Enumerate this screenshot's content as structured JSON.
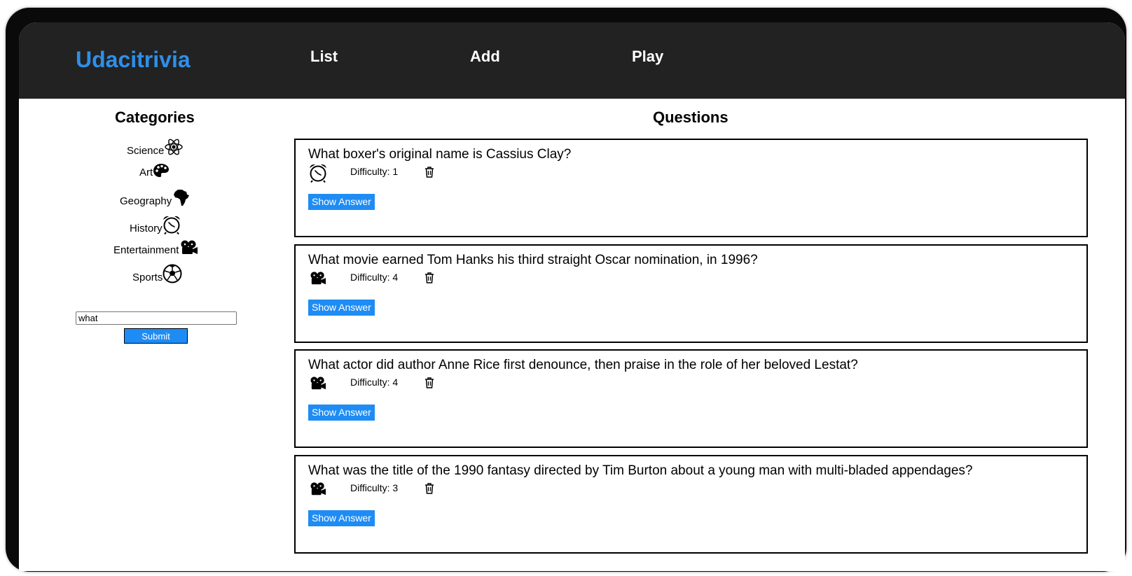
{
  "navbar": {
    "brand": "Udacitrivia",
    "links": [
      "List",
      "Add",
      "Play"
    ]
  },
  "sidebar": {
    "title": "Categories",
    "categories": [
      {
        "label": "Science",
        "icon": "science-atom-icon"
      },
      {
        "label": "Art",
        "icon": "art-palette-icon"
      },
      {
        "label": "Geography",
        "icon": "geography-africa-icon"
      },
      {
        "label": "History",
        "icon": "history-alarm-clock-icon"
      },
      {
        "label": "Entertainment",
        "icon": "entertainment-film-projector-icon"
      },
      {
        "label": "Sports",
        "icon": "sports-soccer-ball-icon"
      }
    ],
    "search": {
      "value": "what",
      "submit_label": "Submit"
    }
  },
  "main": {
    "title": "Questions",
    "show_answer_label": "Show Answer",
    "questions": [
      {
        "text": "What boxer's original name is Cassius Clay?",
        "difficulty": "Difficulty: 1",
        "category_icon": "history-alarm-clock-icon"
      },
      {
        "text": "What movie earned Tom Hanks his third straight Oscar nomination, in 1996?",
        "difficulty": "Difficulty: 4",
        "category_icon": "entertainment-film-projector-icon"
      },
      {
        "text": "What actor did author Anne Rice first denounce, then praise in the role of her beloved Lestat?",
        "difficulty": "Difficulty: 4",
        "category_icon": "entertainment-film-projector-icon"
      },
      {
        "text": "What was the title of the 1990 fantasy directed by Tim Burton about a young man with multi-bladed appendages?",
        "difficulty": "Difficulty: 3",
        "category_icon": "entertainment-film-projector-icon"
      }
    ]
  },
  "colors": {
    "navbar_bg": "#222222",
    "brand": "#2e8fea",
    "button_bg": "#1e8cf4"
  }
}
